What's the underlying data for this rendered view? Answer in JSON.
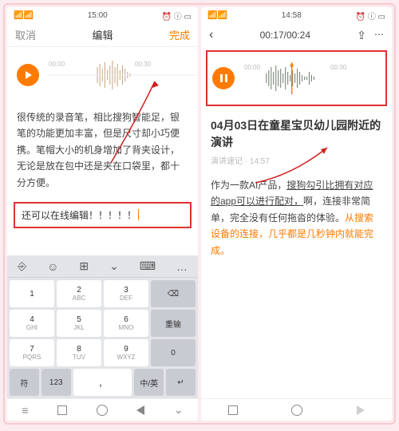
{
  "left": {
    "status": {
      "time": "15:00",
      "icons": "⏰ ⓘ ▭"
    },
    "header": {
      "cancel": "取消",
      "title": "编辑",
      "done": "完成"
    },
    "wave_ticks": {
      "a": "00:00",
      "b": "00:30"
    },
    "paragraph": "很传统的录音笔，相比搜狗智能足，银笔的功能更加丰富，但是尺寸却小巧便携。笔帽大小的机身增加了背夹设计，无论是放在包中还是夹在口袋里，都十分方便。",
    "edit_line": "还可以在线编辑！！！！！",
    "keyboard": {
      "top": [
        "⎆",
        "☺",
        "⊞",
        "⌄",
        "⌨",
        "…"
      ],
      "rows": [
        [
          {
            "n": "1",
            "s": ""
          },
          {
            "n": "2",
            "s": "ABC"
          },
          {
            "n": "3",
            "s": "DEF"
          },
          {
            "n": "⌫",
            "s": ""
          }
        ],
        [
          {
            "n": "4",
            "s": "GHI"
          },
          {
            "n": "5",
            "s": "JKL"
          },
          {
            "n": "6",
            "s": "MNO"
          },
          {
            "n": "重输",
            "s": ""
          }
        ],
        [
          {
            "n": "7",
            "s": "PQRS"
          },
          {
            "n": "8",
            "s": "TUV"
          },
          {
            "n": "9",
            "s": "WXYZ"
          },
          {
            "n": "0",
            "s": ""
          }
        ]
      ],
      "bottom": {
        "sym": "符",
        "num": "123",
        "space": "，",
        "lang": "中/英",
        "enter": "↵"
      }
    }
  },
  "right": {
    "status": {
      "time": "14:58",
      "icons": "⏰ ⓘ ▭"
    },
    "header": {
      "timer": "00:17/00:24",
      "share": "⇪",
      "more": "⋯"
    },
    "wave_ticks": {
      "a": "00:00",
      "b": "00:30"
    },
    "title": "04月03日在童星宝贝幼儿园附近的演讲",
    "meta": "演讲速记  ·  14:57",
    "paragraph_a": "作为一款AI产品，",
    "paragraph_b": "搜狗勾引比拥有对应的app可以进行配对，",
    "paragraph_c": "啊，连接非常简单，完全没有任何拖沓的体验。",
    "paragraph_d": "从搜索设备的连接，几乎都是几秒钟内就能完成。"
  }
}
